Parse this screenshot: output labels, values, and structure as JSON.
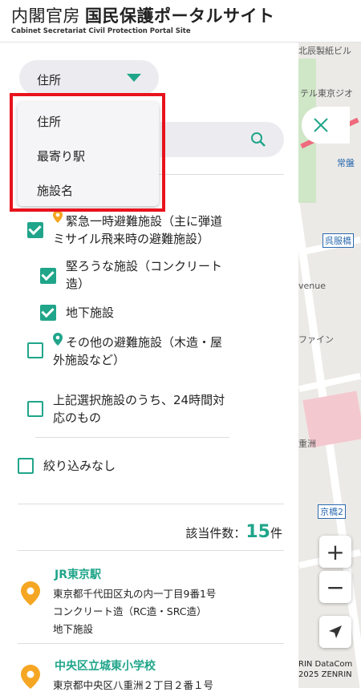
{
  "header": {
    "title_prefix": "内閣官房",
    "title_main": "国民保護ポータルサイト",
    "subtitle": "Cabinet Secretariat Civil Protection Portal Site"
  },
  "search": {
    "type_selected": "住所",
    "type_options": [
      "住所",
      "最寄り駅",
      "施設名"
    ]
  },
  "filters": {
    "emergency_label": "緊急一時避難施設（主に弾道ミサイル飛来時の避難施設）",
    "emergency_line1": "緊急一時避難施設（主に弾道",
    "emergency_line2": "ミサイル飛来時の避難施設）",
    "sturdy_line1": "堅ろうな施設（コンクリート",
    "sturdy_line2": "造）",
    "underground": "地下施設",
    "other_line1": "その他の避難施設（木造・屋",
    "other_line2": "外施設など）",
    "allday_line1": "上記選択施設のうち、24時間対",
    "allday_line2": "応のもの",
    "no_filter": "絞り込みなし"
  },
  "results": {
    "count_label": "該当件数：",
    "count": "15",
    "count_unit": "件",
    "items": [
      {
        "name": "JR東京駅",
        "address": "東京都千代田区丸の内一丁目9番1号",
        "structure": "コンクリート造（RC造・SRC造）",
        "type": "地下施設"
      },
      {
        "name": "中央区立城東小学校",
        "address": "東京都中央区八重洲２丁目２番１号"
      }
    ]
  },
  "map": {
    "labels": {
      "bldg": "北辰製紙ビル",
      "hotel": "テル東京ジオ",
      "joban": "常盤",
      "gofuku": "呉服橋",
      "avenue": "venue",
      "fine": "ファイン",
      "yaesu": "重洲",
      "kyobashi": "京橋2",
      "copyright1": "RIN DataCom",
      "copyright2": "2025 ZENRIN"
    }
  },
  "colors": {
    "accent": "#20a58a",
    "pin": "#f5a623",
    "highlight": "#e8131d"
  }
}
